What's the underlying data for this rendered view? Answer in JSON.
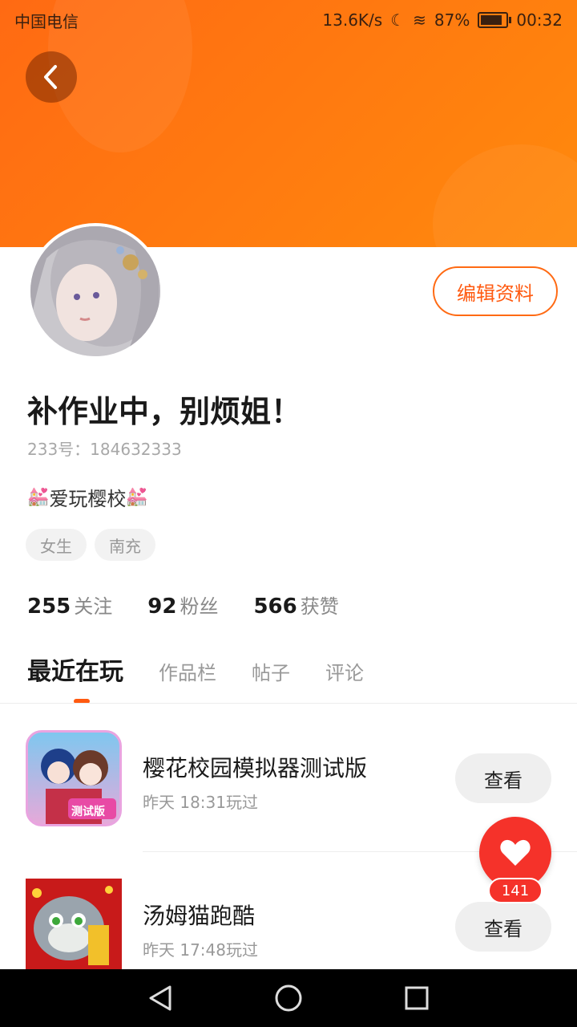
{
  "status_bar": {
    "carrier": "中国电信",
    "speed": "13.6K/s",
    "battery": "87%",
    "time": "00:32"
  },
  "profile": {
    "edit_label": "编辑资料",
    "nickname": "补作业中，别烦姐！",
    "uid": "233号：184632333",
    "bio_emoji": "💒",
    "bio_text": "爱玩樱校",
    "tags": [
      "女生",
      "南充"
    ],
    "stats": {
      "following_num": "255",
      "following_label": "关注",
      "fans_num": "92",
      "fans_label": "粉丝",
      "likes_num": "566",
      "likes_label": "获赞"
    }
  },
  "tabs": [
    "最近在玩",
    "作品栏",
    "帖子",
    "评论"
  ],
  "games": [
    {
      "name": "樱花校园模拟器测试版",
      "time": "昨天 18:31玩过",
      "icon_badge": "测试版",
      "action": "查看"
    },
    {
      "name": "汤姆猫跑酷",
      "time": "昨天 17:48玩过",
      "action": "查看"
    }
  ],
  "like_fab": {
    "count": "141"
  },
  "colors": {
    "accent": "#ff6a13",
    "like": "#f5322a"
  },
  "icons": [
    "back-arrow-icon",
    "heart-icon",
    "nav-back-icon",
    "nav-home-icon",
    "nav-recents-icon"
  ]
}
